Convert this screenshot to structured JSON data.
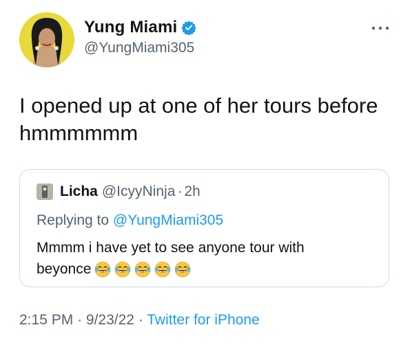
{
  "tweet": {
    "author": {
      "name": "Yung Miami",
      "handle": "@YungMiami305"
    },
    "text_line1": "I opened up at one of her tours before",
    "text_line2": "hmmmmmm",
    "time": "2:15 PM",
    "date": "9/23/22",
    "source": "Twitter for iPhone",
    "icons": {
      "verified": "verified-badge-icon",
      "more": "more-options-icon"
    }
  },
  "quote": {
    "name": "Licha",
    "handle": "@IcyyNinja",
    "time": "2h",
    "replying_label": "Replying to",
    "replying_to": "@YungMiami305",
    "text_line1": "Mmmm i have yet to see anyone tour with",
    "text_line2": "beyonce",
    "emoji": "face-with-tears-of-joy",
    "emoji_count": 5
  },
  "colors": {
    "accent": "#1d9bf0",
    "secondary_text": "#536471",
    "border": "#cfd9de",
    "avatar_bg": "#e8d93a"
  }
}
